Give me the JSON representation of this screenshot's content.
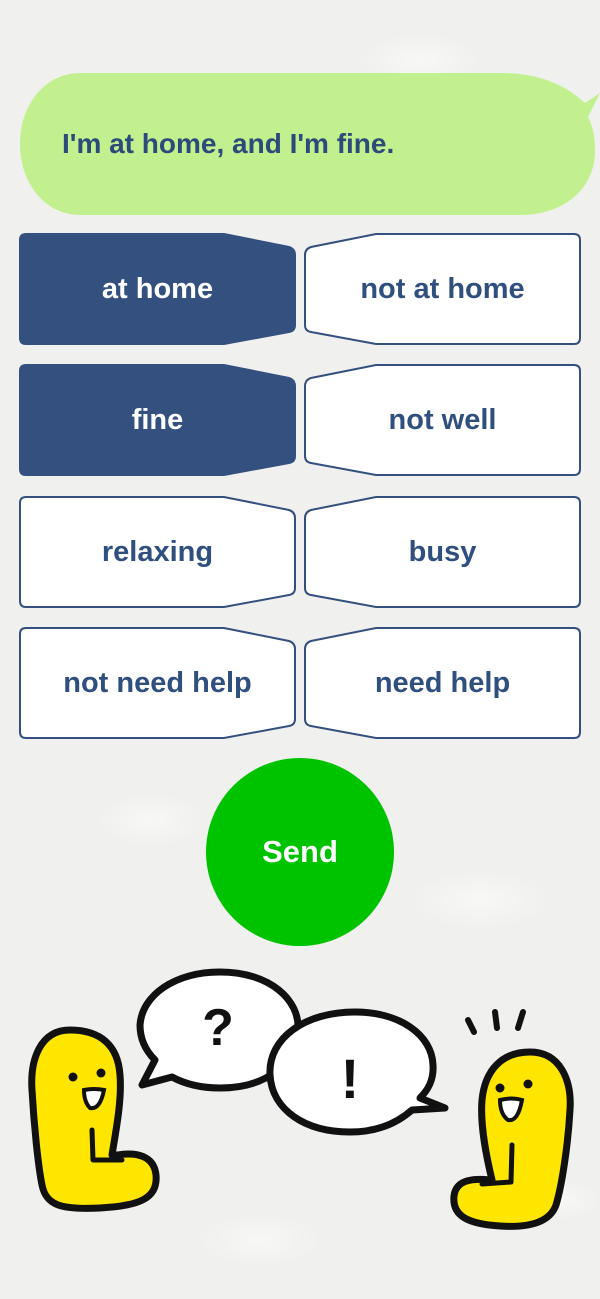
{
  "message": {
    "text": "I'm at home, and I'm fine."
  },
  "options": [
    {
      "label": "at home",
      "selected": true
    },
    {
      "label": "not at home",
      "selected": false
    },
    {
      "label": "fine",
      "selected": true
    },
    {
      "label": "not well",
      "selected": false
    },
    {
      "label": "relaxing",
      "selected": false
    },
    {
      "label": "busy",
      "selected": false
    },
    {
      "label": "not need help",
      "selected": false
    },
    {
      "label": "need help",
      "selected": false
    }
  ],
  "send": {
    "label": "Send"
  },
  "colors": {
    "bubble": "#c3f08f",
    "selected_fill": "#33507f",
    "outline": "#33507f",
    "unselected_fill": "#ffffff",
    "send": "#00c300",
    "character": "#ffe600"
  },
  "illustration": {
    "left_bubble_symbol": "?",
    "right_bubble_symbol": "!"
  }
}
